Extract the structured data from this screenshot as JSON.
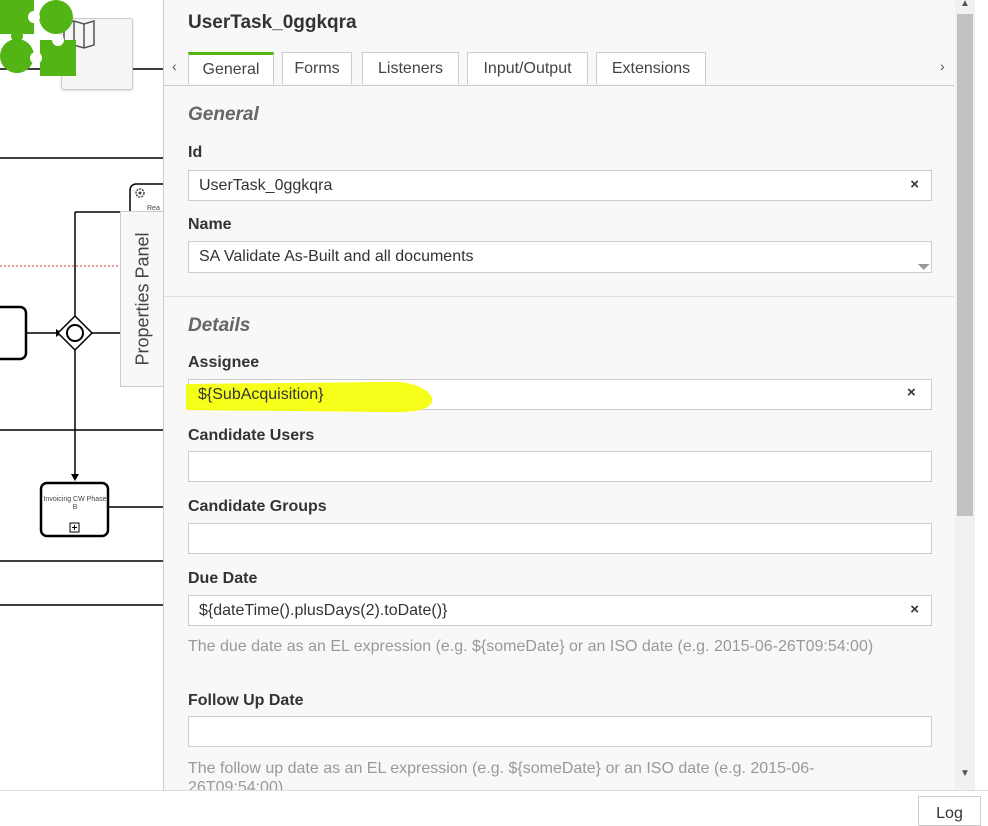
{
  "canvas": {
    "properties_toggle_label": "Properties Panel",
    "task_invoicing_label": "Invoicing CW Phase B",
    "task_partial_label": "Rea",
    "icons": [
      "map-icon",
      "gateway-icon",
      "expand-icon",
      "service-task-icon",
      "camunda-logo"
    ]
  },
  "panel": {
    "title": "UserTask_0ggkqra",
    "tabs": [
      "General",
      "Forms",
      "Listeners",
      "Input/Output",
      "Extensions"
    ],
    "active_tab": "General",
    "tab_left_arrow": "‹",
    "tab_right_arrow": "›",
    "groups": {
      "general": {
        "title": "General",
        "id_label": "Id",
        "id_value": "UserTask_0ggkqra",
        "name_label": "Name",
        "name_value": "SA Validate As-Built and all documents"
      },
      "details": {
        "title": "Details",
        "assignee_label": "Assignee",
        "assignee_value": "${SubAcquisition}",
        "candidate_users_label": "Candidate Users",
        "candidate_users_value": "",
        "candidate_groups_label": "Candidate Groups",
        "candidate_groups_value": "",
        "due_date_label": "Due Date",
        "due_date_value": "${dateTime().plusDays(2).toDate()}",
        "due_date_hint": "The due date as an EL expression (e.g. ${someDate} or an ISO date (e.g. 2015-06-26T09:54:00)",
        "follow_up_label": "Follow Up Date",
        "follow_up_value": "",
        "follow_up_hint": "The follow up date as an EL expression (e.g. ${someDate} or an ISO date (e.g. 2015-06-26T09:54:00)"
      }
    },
    "clear_glyph": "×"
  },
  "log_button": "Log",
  "colors": {
    "accent": "#52b415",
    "highlight": "#f5ff00",
    "logo_green": "#52b415"
  }
}
